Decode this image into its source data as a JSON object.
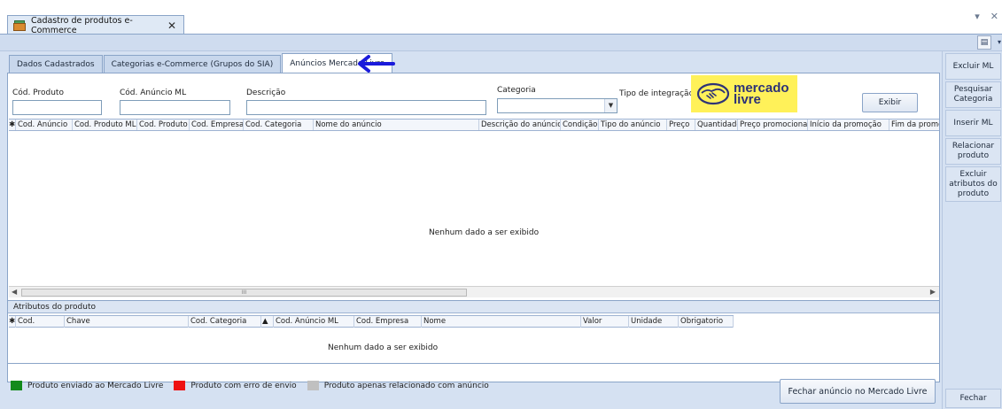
{
  "window": {
    "doc_tab_title": "Cadastro de produtos e-Commerce",
    "close_glyph": "✕",
    "ctrl_dropdown": "▾",
    "ctrl_close": "✕"
  },
  "tabs": [
    {
      "label": "Dados Cadastrados"
    },
    {
      "label": "Categorias e-Commerce (Grupos do SIA)"
    },
    {
      "label": "Anúncios Mercado Livre"
    }
  ],
  "filters": {
    "cod_produto_label": "Cód. Produto",
    "cod_anuncio_label": "Cód. Anúncio ML",
    "descricao_label": "Descrição",
    "categoria_label": "Categoria",
    "tipo_integracao_label": "Tipo de integração:",
    "exibir_label": "Exibir"
  },
  "logo": {
    "line1": "mercado",
    "line2": "livre"
  },
  "grid": {
    "columns": [
      "Cod. Anúncio",
      "Cod. Produto ML",
      "Cod. Produto",
      "Cod. Empresa",
      "Cod. Categoria",
      "Nome do anúncio",
      "Descrição do anúncio",
      "Condição",
      "Tipo do anúncio",
      "Preço",
      "Quantidade",
      "Preço promocional",
      "Início da promoção",
      "Fim da promoção"
    ],
    "empty_message": "Nenhum dado a ser exibido",
    "scroll_thumb_label": "III"
  },
  "attributes": {
    "title": "Atributos do produto",
    "columns": [
      "Cod.",
      "Chave",
      "Cod. Categoria",
      "Cod. Anúncio ML",
      "Cod. Empresa",
      "Nome",
      "Valor",
      "Unidade",
      "Obrigatorio"
    ],
    "empty_message": "Nenhum dado a ser exibido"
  },
  "legend": [
    {
      "label": "Produto enviado ao Mercado Livre",
      "color": "#138a1b"
    },
    {
      "label": "Produto com erro de envio",
      "color": "#ee1111"
    },
    {
      "label": "Produto apenas relacionado com anúncio",
      "color": "#c0c0c0"
    }
  ],
  "buttons": {
    "fechar_anuncio": "Fechar anúncio no Mercado Livre"
  },
  "side": {
    "excluir_ml": "Excluir ML",
    "pesquisar_categoria": "Pesquisar Categoria",
    "inserir_ml": "Inserir ML",
    "relacionar_produto": "Relacionar produto",
    "excluir_atributos": "Excluir atributos do produto",
    "fechar": "Fechar"
  },
  "colors": {
    "accent": "#d5e1f2",
    "logo_bg": "#fff159",
    "logo_text": "#2d3277",
    "annotation_arrow": "#1a1adb"
  }
}
